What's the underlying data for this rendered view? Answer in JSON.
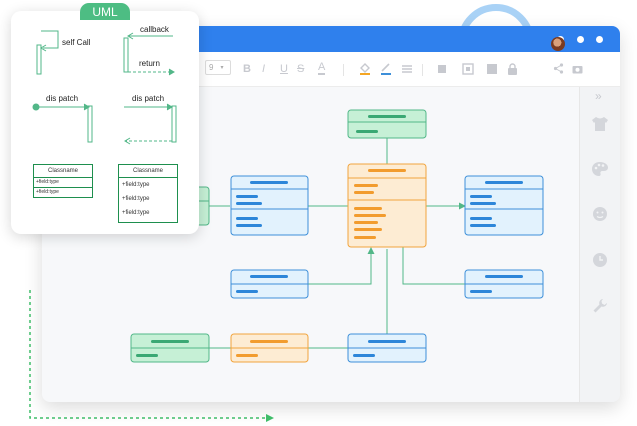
{
  "toolbar": {
    "font_size_value": "9",
    "icons": [
      "bold-icon",
      "italic-icon",
      "underline-icon",
      "strikethrough-icon",
      "font-color-icon",
      "fill-color-icon",
      "line-color-icon",
      "line-style-icon",
      "crop-icon",
      "group-icon",
      "ungroup-icon",
      "lock-icon",
      "share-icon",
      "camera-icon"
    ]
  },
  "sidebar": {
    "collapse_label": "»",
    "icons": [
      "theme-icon",
      "palette-icon",
      "emoji-icon",
      "history-icon",
      "wrench-icon"
    ]
  },
  "uml_panel": {
    "tag_label": "UML",
    "self_call_label": "self Call",
    "callback_label": "callback",
    "return_label": "return",
    "dispatch_label_1": "dis patch",
    "dispatch_label_2": "dis patch",
    "class_small": {
      "name": "Classname",
      "fields": [
        "+field:type",
        "+field:type"
      ]
    },
    "class_large": {
      "name": "Classname",
      "fields": [
        "+field:type",
        "+field:type",
        "+field:type"
      ]
    }
  },
  "colors": {
    "titlebar": "#2f80ed",
    "green_fill": "#c6f0d6",
    "green_stroke": "#52b788",
    "blue_fill": "#e2f2fd",
    "blue_stroke": "#3d8fd9",
    "orange_fill": "#fdecd3",
    "orange_stroke": "#f1a43d"
  }
}
